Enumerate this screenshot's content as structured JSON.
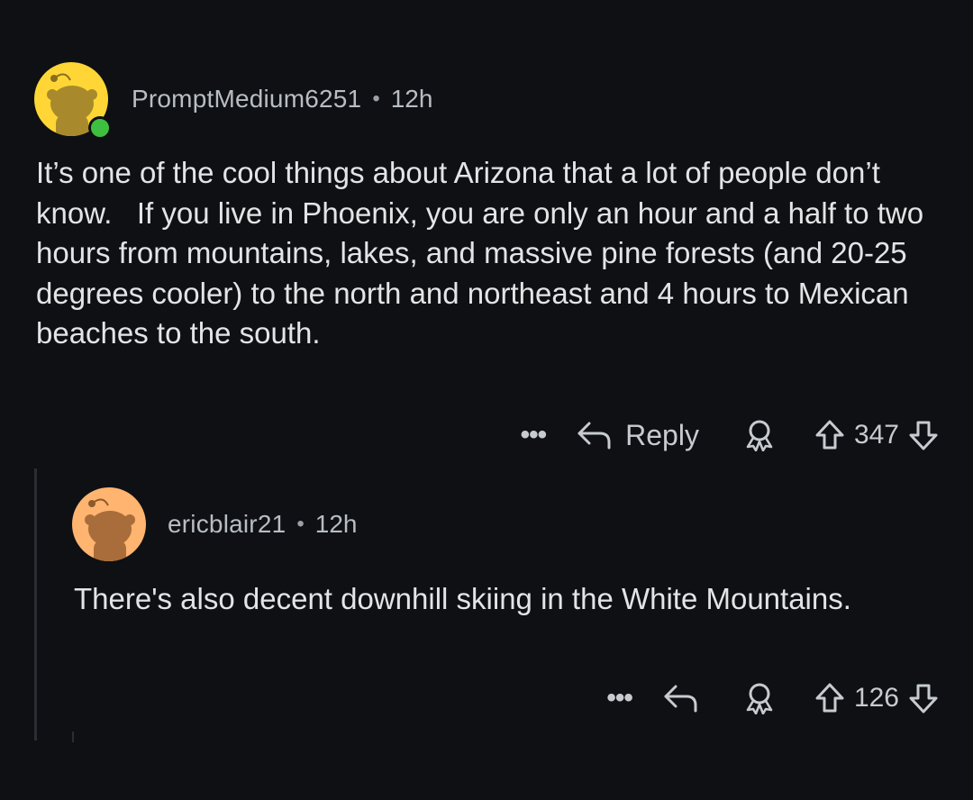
{
  "comments": [
    {
      "username": "PromptMedium6251",
      "separator": "•",
      "time": "12h",
      "avatar_color": "#ffd635",
      "online": true,
      "text": "It’s one of the cool things about Arizona that a lot of people don’t know.   If you live in Phoenix, you are only an hour and a half to two hours from mountains, lakes, and massive pine forests (and 20-25 degrees cooler) to the north and northeast and 4 hours to Mexican beaches to the south.",
      "actions": {
        "more_label": "•••",
        "reply_label": "Reply",
        "score": "347"
      }
    },
    {
      "username": "ericblair21",
      "separator": "•",
      "time": "12h",
      "avatar_color": "#ffb470",
      "online": false,
      "text": "There's also decent downhill skiing in the White Mountains.",
      "actions": {
        "more_label": "•••",
        "score": "126"
      }
    }
  ],
  "icons": [
    "reply-arrow-icon",
    "award-icon",
    "upvote-icon",
    "downvote-icon",
    "more-options-icon",
    "snoo-avatar-icon"
  ]
}
